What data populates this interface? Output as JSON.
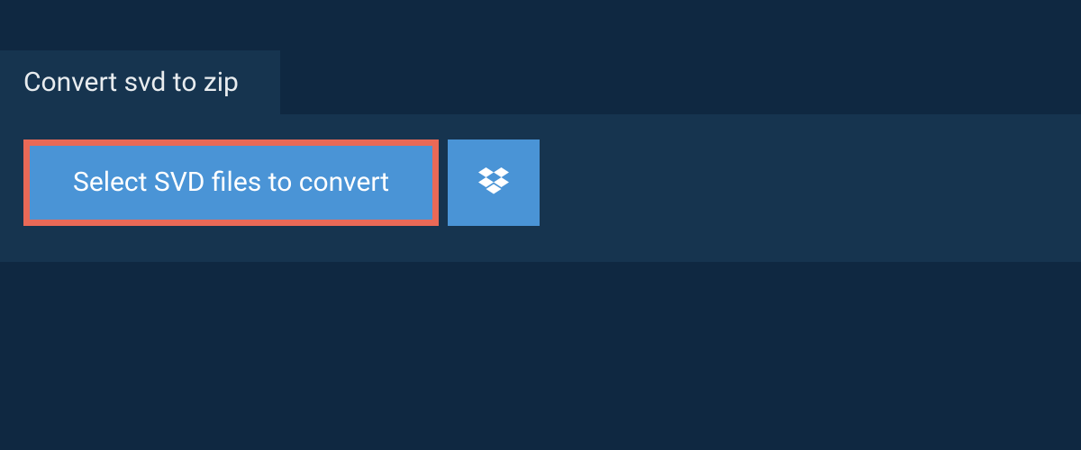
{
  "tab": {
    "label": "Convert svd to zip"
  },
  "actions": {
    "select_label": "Select SVD files to convert"
  },
  "colors": {
    "background": "#0f2841",
    "panel": "#16344f",
    "button": "#4a94d6",
    "highlight_border": "#e96957"
  }
}
